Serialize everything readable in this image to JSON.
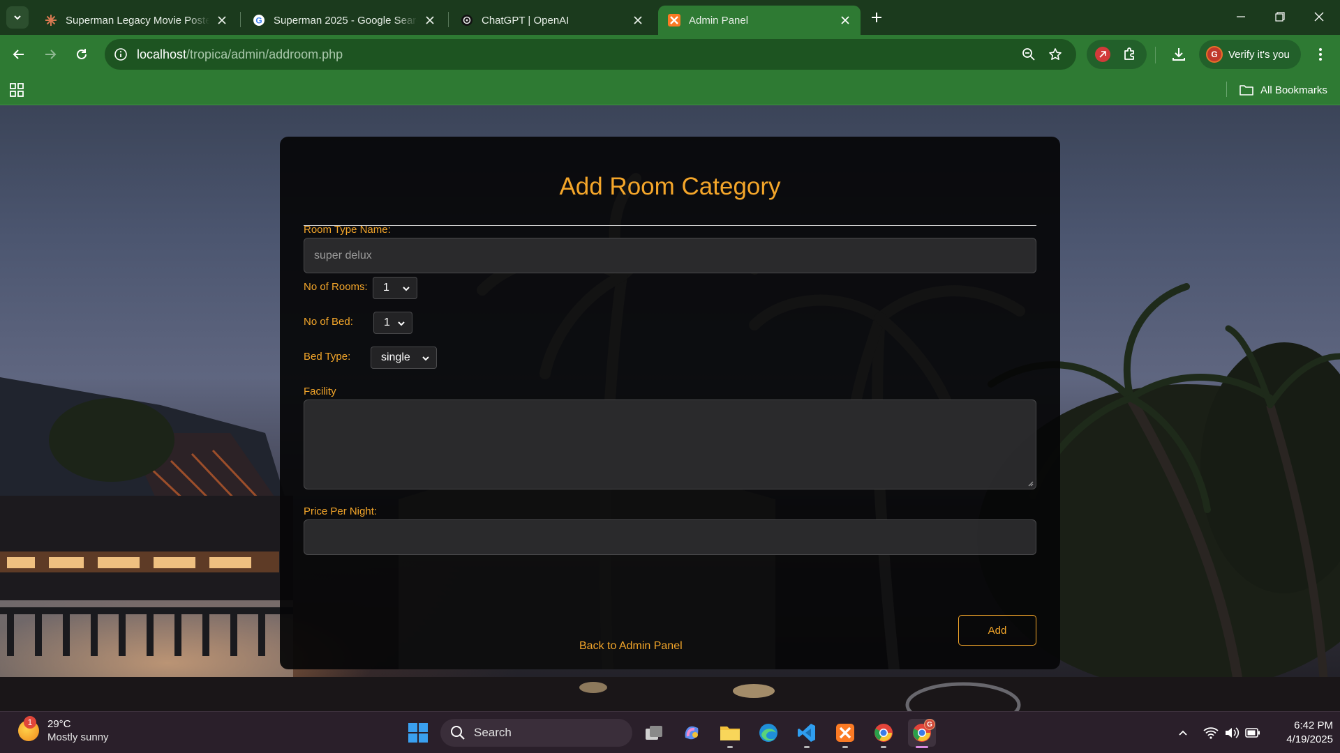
{
  "browser": {
    "tabs": [
      {
        "title": "Superman Legacy Movie Poster",
        "icon": "sparkle-favicon"
      },
      {
        "title": "Superman 2025 - Google Search",
        "icon": "google-favicon"
      },
      {
        "title": "ChatGPT | OpenAI",
        "icon": "openai-favicon"
      },
      {
        "title": "Admin Panel",
        "icon": "xampp-favicon",
        "active": true
      }
    ],
    "url_host": "localhost",
    "url_path": "/tropica/admin/addroom.php",
    "profile_label": "Verify it's you",
    "profile_initial": "G",
    "bookmarks_label": "All Bookmarks"
  },
  "form": {
    "title": "Add Room Category",
    "room_type_label": "Room Type Name:",
    "room_type_value": "super delux",
    "rooms_label": "No of Rooms:",
    "rooms_value": "1",
    "bed_label": "No of Bed:",
    "bed_value": "1",
    "bed_type_label": "Bed Type:",
    "bed_type_value": "single",
    "facility_label": "Facility",
    "facility_value": "",
    "price_label": "Price Per Night:",
    "price_value": "",
    "back_link": "Back to Admin Panel",
    "add_button": "Add"
  },
  "taskbar": {
    "weather_temp": "29°C",
    "weather_desc": "Mostly sunny",
    "weather_badge": "1",
    "search_label": "Search",
    "chrome_badge": "G",
    "time": "6:42 PM",
    "date": "4/19/2025"
  },
  "colors": {
    "accent": "#f4a62a",
    "chrome_green": "#2e7a33",
    "tabstrip": "#1b3a1d"
  }
}
